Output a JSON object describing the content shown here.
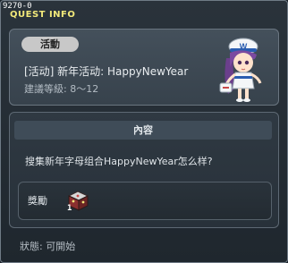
{
  "header": {
    "quest_id": "9270-0",
    "title": "QUEST INFO"
  },
  "quest": {
    "tag": "活動",
    "name": "[活动] 新年活动: HappyNewYear",
    "level": "建議等級: 8～12"
  },
  "content": {
    "section_title": "內容",
    "description": "搜集新年字母组合HappyNewYear怎么样?"
  },
  "reward": {
    "label": "獎勵",
    "item_icon": "treasure-chest-icon",
    "quantity": "1"
  },
  "status": "狀態: 可開始",
  "colors": {
    "title_yellow": "#f2e97a",
    "panel": "#3d4852",
    "background": "#1f272e"
  }
}
